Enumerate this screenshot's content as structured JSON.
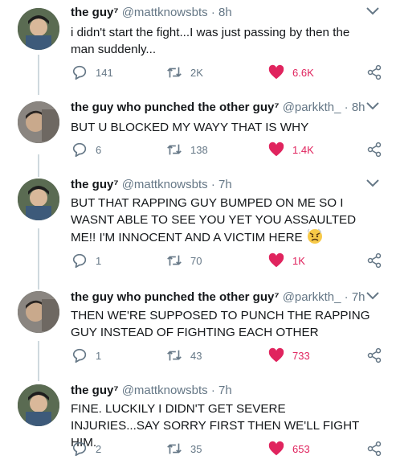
{
  "tweets": [
    {
      "name": "the guy⁷",
      "handle": "@mattknowsbts",
      "time": "8h",
      "text": "i didn't start the fight...I was just passing by then the man suddenly...",
      "replies": "141",
      "retweets": "2K",
      "likes": "6.6K"
    },
    {
      "name": "the guy who punched the other guy⁷",
      "handle": "@parkkth_",
      "time": "8h",
      "text": "BUT U BLOCKED MY WAYY THAT IS WHY",
      "replies": "6",
      "retweets": "138",
      "likes": "1.4K"
    },
    {
      "name": "the guy⁷",
      "handle": "@mattknowsbts",
      "time": "7h",
      "text": "BUT THAT RAPPING GUY BUMPED ON ME SO I WASNT ABLE TO SEE YOU YET YOU ASSAULTED ME!! I'M INNOCENT AND A VICTIM HERE",
      "emoji": "angry-face-emoji",
      "replies": "1",
      "retweets": "70",
      "likes": "1K"
    },
    {
      "name": "the guy who punched the other guy⁷",
      "handle": "@parkkth_",
      "time": "7h",
      "text": "THEN WE'RE SUPPOSED TO PUNCH THE RAPPING GUY INSTEAD OF FIGHTING EACH OTHER",
      "replies": "1",
      "retweets": "43",
      "likes": "733"
    },
    {
      "name": "the guy⁷",
      "handle": "@mattknowsbts",
      "time": "7h",
      "text": "FINE. LUCKILY I DIDN'T GET SEVERE INJURIES...SAY SORRY FIRST THEN WE'LL FIGHT HIM.",
      "replies": "2",
      "retweets": "35",
      "likes": "653"
    }
  ],
  "separator": "·",
  "colors": {
    "like": "#e0245e",
    "muted": "#657786",
    "text": "#14171a",
    "thread": "#cfd9de"
  },
  "icons": [
    "reply-icon",
    "retweet-icon",
    "heart-icon",
    "share-icon",
    "chevron-down-icon"
  ]
}
